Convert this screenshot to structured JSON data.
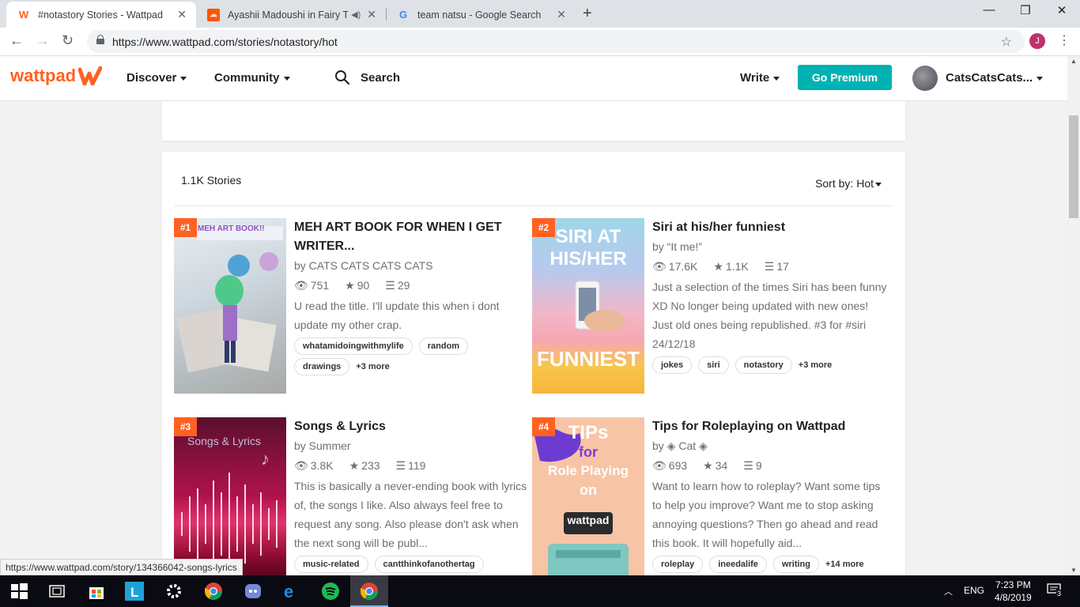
{
  "browser": {
    "tabs": [
      {
        "title": "#notastory Stories - Wattpad",
        "active": true
      },
      {
        "title": "Ayashii Madoushi in Fairy Tai",
        "active": false
      },
      {
        "title": "team natsu - Google Search",
        "active": false
      }
    ],
    "url": "https://www.wattpad.com/stories/notastory/hot",
    "profile_initial": "J",
    "status_url": "https://www.wattpad.com/story/134366042-songs-lyrics"
  },
  "header": {
    "logo_text": "wattpad",
    "nav": [
      "Discover",
      "Community"
    ],
    "search_label": "Search",
    "write_label": "Write",
    "premium_label": "Go Premium",
    "username": "CatsCatsCats..."
  },
  "listing": {
    "count": "1.1K Stories",
    "sort_label": "Sort by:",
    "sort_value": "Hot"
  },
  "stories": [
    {
      "rank": "#1",
      "title_line1": "MEH ART BOOK FOR WHEN I GET",
      "title_line2": "WRITER...",
      "author": "by CATS CATS CATS CATS",
      "views": "751",
      "votes": "90",
      "parts": "29",
      "description": "U read the title. I'll update this when i dont update my other crap.",
      "tags": [
        "whatamidoingwithmylife",
        "random",
        "drawings"
      ],
      "more": "+3 more",
      "cover_text": "MEH ART BOOK!!"
    },
    {
      "rank": "#2",
      "title_line1": "Siri at his/her funniest",
      "title_line2": "",
      "author": "by “It me!”",
      "views": "17.6K",
      "votes": "1.1K",
      "parts": "17",
      "description": "Just a selection of the times Siri has been funny XD No longer being updated with new ones! Just old ones being republished. #3 for #siri 24/12/18",
      "tags": [
        "jokes",
        "siri",
        "notastory"
      ],
      "more": "+3 more",
      "cover_text1": "SIRI AT",
      "cover_text2": "HIS/HER",
      "cover_text3": "FUNNIEST"
    },
    {
      "rank": "#3",
      "title_line1": "Songs & Lyrics",
      "title_line2": "",
      "author": "by Summer",
      "views": "3.8K",
      "votes": "233",
      "parts": "119",
      "description": "This is basically a never-ending book with lyrics of, the songs I like. Also always feel free to request any song. Also please don't ask when the next song will be publ...",
      "tags": [
        "music-related",
        "cantthinkofanothertag"
      ],
      "more": "",
      "cover_text": "Songs & Lyrics"
    },
    {
      "rank": "#4",
      "title_line1": "Tips for Roleplaying on Wattpad",
      "title_line2": "",
      "author": "by ◈ Cat ◈",
      "views": "693",
      "votes": "34",
      "parts": "9",
      "description": "Want to learn how to roleplay? Want some tips to help you improve? Want me to stop asking annoying questions? Then go ahead and read this book. It will hopefully aid...",
      "tags": [
        "roleplay",
        "ineedalife",
        "writing"
      ],
      "more": "+14 more",
      "cover_text1": "TIPs",
      "cover_text2": "for",
      "cover_text3": "Role Playing",
      "cover_text4": "on",
      "cover_text5": "wattpad"
    }
  ],
  "taskbar": {
    "language": "ENG",
    "time": "7:23 PM",
    "date": "4/8/2019",
    "notifications": "3"
  },
  "colors": {
    "wattpad_orange": "#ff6122",
    "premium_teal": "#00b2b2"
  }
}
